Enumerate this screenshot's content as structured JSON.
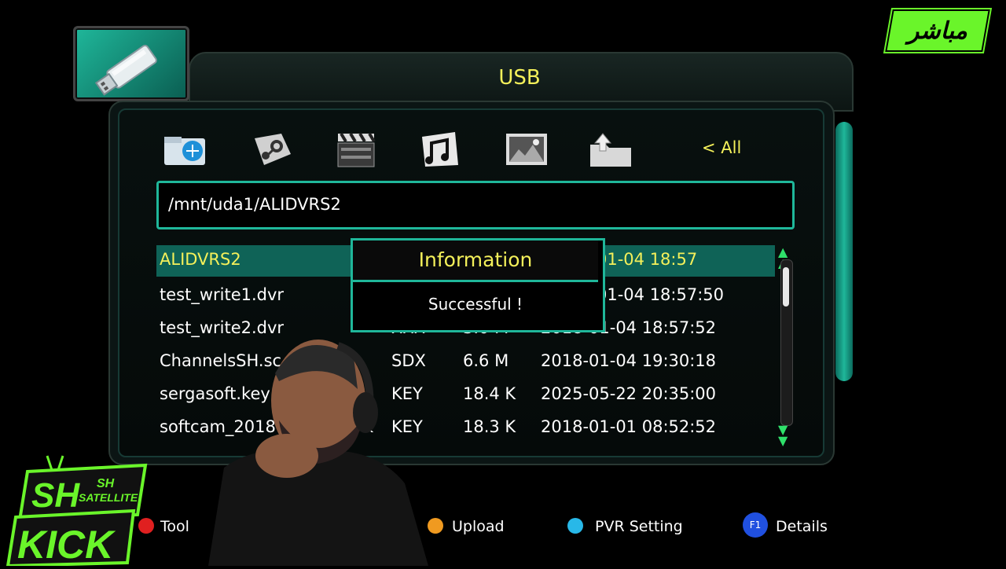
{
  "badge": {
    "live_text": "مباشر",
    "color": "#6af52a"
  },
  "header": {
    "title": "USB",
    "title_color": "#f4f05a",
    "accent": "#1fb79a"
  },
  "categories": {
    "icons": [
      "network-folder-icon",
      "steam-icon",
      "video-clapper-icon",
      "music-icon",
      "picture-icon",
      "folder-up-icon"
    ],
    "all_label": "< All"
  },
  "path": {
    "value": "/mnt/uda1/ALIDVRS2"
  },
  "files": [
    {
      "name": "ALIDVRS2",
      "type": "",
      "size": "",
      "date": "01-04 18:57",
      "selected": true
    },
    {
      "name": "test_write1.dvr",
      "type": "",
      "size": "",
      "date": "01-04 18:57:50"
    },
    {
      "name": "test_write2.dvr",
      "type": "XXX",
      "size": "3.0 M",
      "date": "2018-01-04 18:57:52"
    },
    {
      "name": "ChannelsSH.sc",
      "type": "SDX",
      "size": "6.6 M",
      "date": "2018-01-04 19:30:18"
    },
    {
      "name": "sergasoft.key",
      "type": "KEY",
      "size": "18.4 K",
      "date": "2025-05-22 20:35:00"
    },
    {
      "name": "softcam_2018",
      "name_suffix": "k",
      "type": "KEY",
      "size": "18.3 K",
      "date": "2018-01-01 08:52:52"
    }
  ],
  "dialog": {
    "title": "Information",
    "message": "Successful !"
  },
  "footer": {
    "keys": [
      {
        "label": "Tool",
        "color": "#e02020"
      },
      {
        "label": "Upload",
        "color": "#f09a20"
      },
      {
        "label": "PVR Setting",
        "color": "#28b8e8"
      },
      {
        "label": "Details",
        "key": "F1",
        "color": "#2050e0"
      }
    ]
  },
  "logo": {
    "line1": "SH",
    "line2": "SH",
    "line3": "SATELLITE",
    "line4": "KICK"
  }
}
